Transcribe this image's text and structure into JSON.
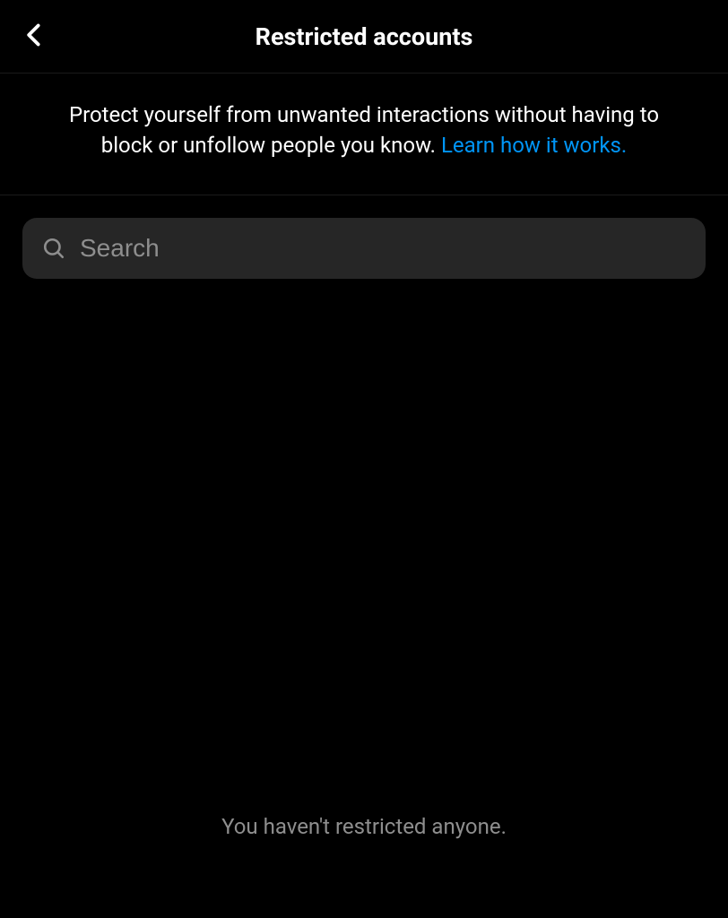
{
  "header": {
    "title": "Restricted accounts"
  },
  "description": {
    "text": "Protect yourself from unwanted interactions without having to block or unfollow people you know. ",
    "link_text": "Learn how it works."
  },
  "search": {
    "placeholder": "Search",
    "value": ""
  },
  "empty_state": {
    "message": "You haven't restricted anyone."
  }
}
